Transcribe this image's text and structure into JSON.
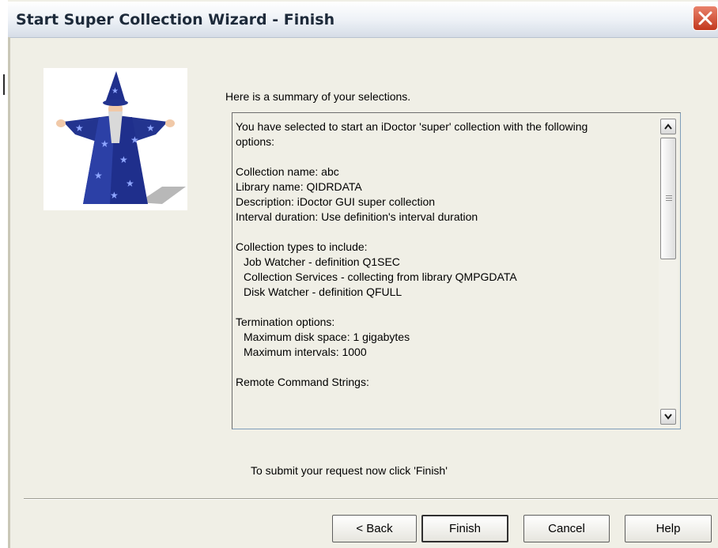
{
  "window": {
    "title": "Start Super Collection Wizard - Finish",
    "close_icon": "close-icon"
  },
  "image": {
    "icon": "wizard-icon"
  },
  "summary": {
    "heading": "Here is a summary of your selections.",
    "lines": {
      "intro1": "You have selected to start an iDoctor 'super' collection with the following",
      "intro2": "options:",
      "collection_name": "Collection name:  abc",
      "library_name": "Library name:  QIDRDATA",
      "description": "Description:  iDoctor GUI super collection",
      "interval": "Interval duration:  Use definition's interval duration",
      "types_header": "Collection types to include:",
      "type_job_watcher": "Job Watcher - definition Q1SEC",
      "type_collection_services": "Collection Services - collecting from library QMPGDATA",
      "type_disk_watcher": "Disk Watcher - definition QFULL",
      "termination_header": "Termination options:",
      "max_disk": "Maximum disk space:  1 gigabytes",
      "max_intervals": "Maximum intervals:  1000",
      "remote_header": "Remote Command Strings:"
    }
  },
  "instruction": "To submit your request now click 'Finish'",
  "buttons": {
    "back": "< Back",
    "finish": "Finish",
    "cancel": "Cancel",
    "help": "Help"
  },
  "colors": {
    "title_text": "#1d2a3a",
    "dialog_bg": "#f0efe6",
    "close_button": "#c2381e",
    "wizard_robe": "#1f2f8c"
  }
}
